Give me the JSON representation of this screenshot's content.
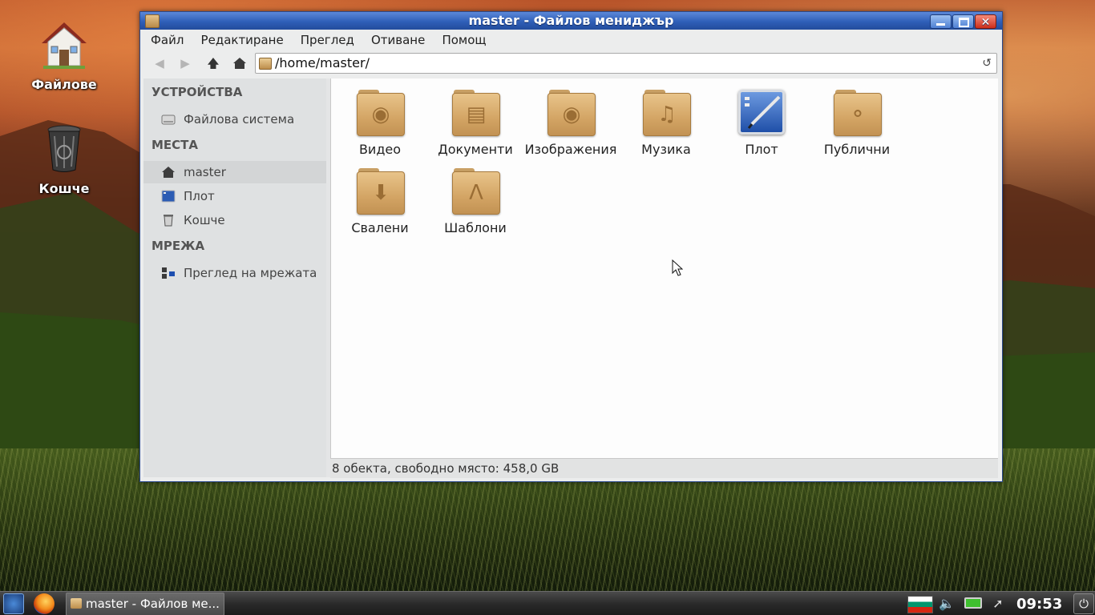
{
  "desktop": {
    "icons": [
      {
        "label": "Файлове",
        "icon": "home-icon"
      },
      {
        "label": "Кошче",
        "icon": "trash-icon"
      }
    ]
  },
  "window": {
    "title": "master - Файлов мениджър",
    "menu": [
      "Файл",
      "Редактиране",
      "Преглед",
      "Отиване",
      "Помощ"
    ],
    "address": "/home/master/",
    "sidebar": {
      "sections": [
        {
          "title": "УСТРОЙСТВА",
          "items": [
            {
              "label": "Файлова система",
              "icon": "drive-icon"
            }
          ]
        },
        {
          "title": "МЕСТА",
          "items": [
            {
              "label": "master",
              "icon": "home-icon",
              "selected": true
            },
            {
              "label": "Плот",
              "icon": "desktop-icon"
            },
            {
              "label": "Кошче",
              "icon": "trash-icon"
            }
          ]
        },
        {
          "title": "МРЕЖА",
          "items": [
            {
              "label": "Преглед на мрежата",
              "icon": "network-icon"
            }
          ]
        }
      ]
    },
    "files": [
      {
        "name": "Видео",
        "icon": "video-folder-icon"
      },
      {
        "name": "Документи",
        "icon": "documents-folder-icon"
      },
      {
        "name": "Изображения",
        "icon": "pictures-folder-icon"
      },
      {
        "name": "Музика",
        "icon": "music-folder-icon"
      },
      {
        "name": "Плот",
        "icon": "desktop-folder-icon"
      },
      {
        "name": "Публични",
        "icon": "public-folder-icon"
      },
      {
        "name": "Свалени",
        "icon": "downloads-folder-icon"
      },
      {
        "name": "Шаблони",
        "icon": "templates-folder-icon"
      }
    ],
    "status": "8 обекта, свободно място: 458,0 GB"
  },
  "taskbar": {
    "task_label": "master - Файлов ме...",
    "clock": "09:53"
  },
  "colors": {
    "titlebar": "#2f5fb8",
    "folder": "#d3a464",
    "sidebar": "#dfe1e2"
  }
}
